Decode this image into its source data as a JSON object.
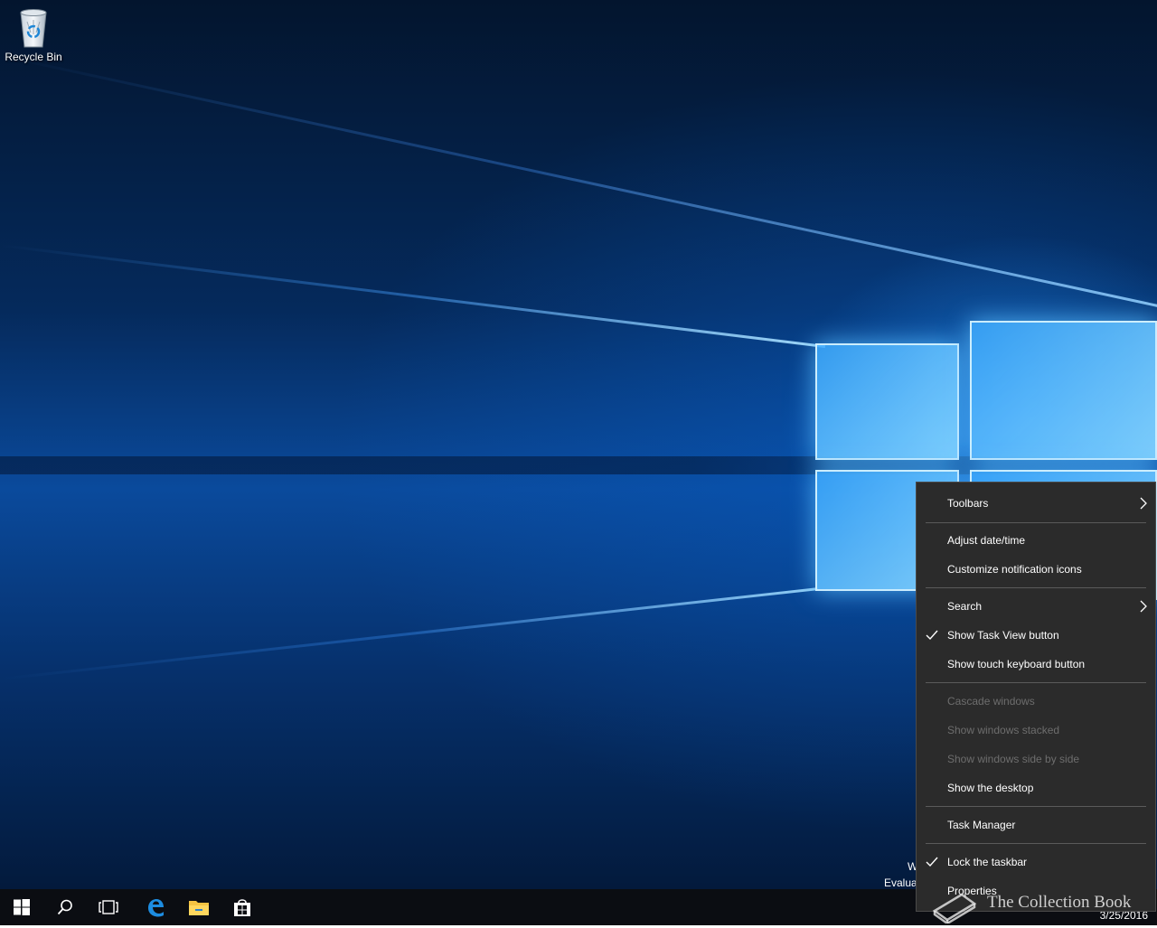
{
  "desktop": {
    "icons": [
      {
        "label": "Recycle Bin",
        "icon": "recycle-bin-icon"
      }
    ],
    "eval_text": {
      "line1": "Wi",
      "line2": "Evaluat"
    }
  },
  "taskbar": {
    "buttons": [
      {
        "name": "start",
        "icon": "windows-logo-icon"
      },
      {
        "name": "search",
        "icon": "search-icon"
      },
      {
        "name": "task-view",
        "icon": "task-view-icon"
      },
      {
        "name": "edge",
        "icon": "edge-icon"
      },
      {
        "name": "file-explorer",
        "icon": "folder-icon"
      },
      {
        "name": "store",
        "icon": "store-icon"
      }
    ],
    "clock": {
      "date": "3/25/2016"
    }
  },
  "context_menu": {
    "items": [
      {
        "label": "Toolbars",
        "has_submenu": true,
        "checked": false,
        "enabled": true
      },
      {
        "label": "Adjust date/time",
        "has_submenu": false,
        "checked": false,
        "enabled": true
      },
      {
        "label": "Customize notification icons",
        "has_submenu": false,
        "checked": false,
        "enabled": true
      },
      {
        "label": "Search",
        "has_submenu": true,
        "checked": false,
        "enabled": true
      },
      {
        "label": "Show Task View button",
        "has_submenu": false,
        "checked": true,
        "enabled": true
      },
      {
        "label": "Show touch keyboard button",
        "has_submenu": false,
        "checked": false,
        "enabled": true
      },
      {
        "label": "Cascade windows",
        "has_submenu": false,
        "checked": false,
        "enabled": false
      },
      {
        "label": "Show windows stacked",
        "has_submenu": false,
        "checked": false,
        "enabled": false
      },
      {
        "label": "Show windows side by side",
        "has_submenu": false,
        "checked": false,
        "enabled": false
      },
      {
        "label": "Show the desktop",
        "has_submenu": false,
        "checked": false,
        "enabled": true
      },
      {
        "label": "Task Manager",
        "has_submenu": false,
        "checked": false,
        "enabled": true
      },
      {
        "label": "Lock the taskbar",
        "has_submenu": false,
        "checked": true,
        "enabled": true
      },
      {
        "label": "Properties",
        "has_submenu": false,
        "checked": false,
        "enabled": true
      }
    ]
  },
  "watermark": {
    "text": "The Collection Book",
    "icon": "book-icon"
  },
  "colors": {
    "menu_bg": "#2b2b2b",
    "taskbar_bg": "#0b0d12",
    "accent": "#0078d7"
  }
}
